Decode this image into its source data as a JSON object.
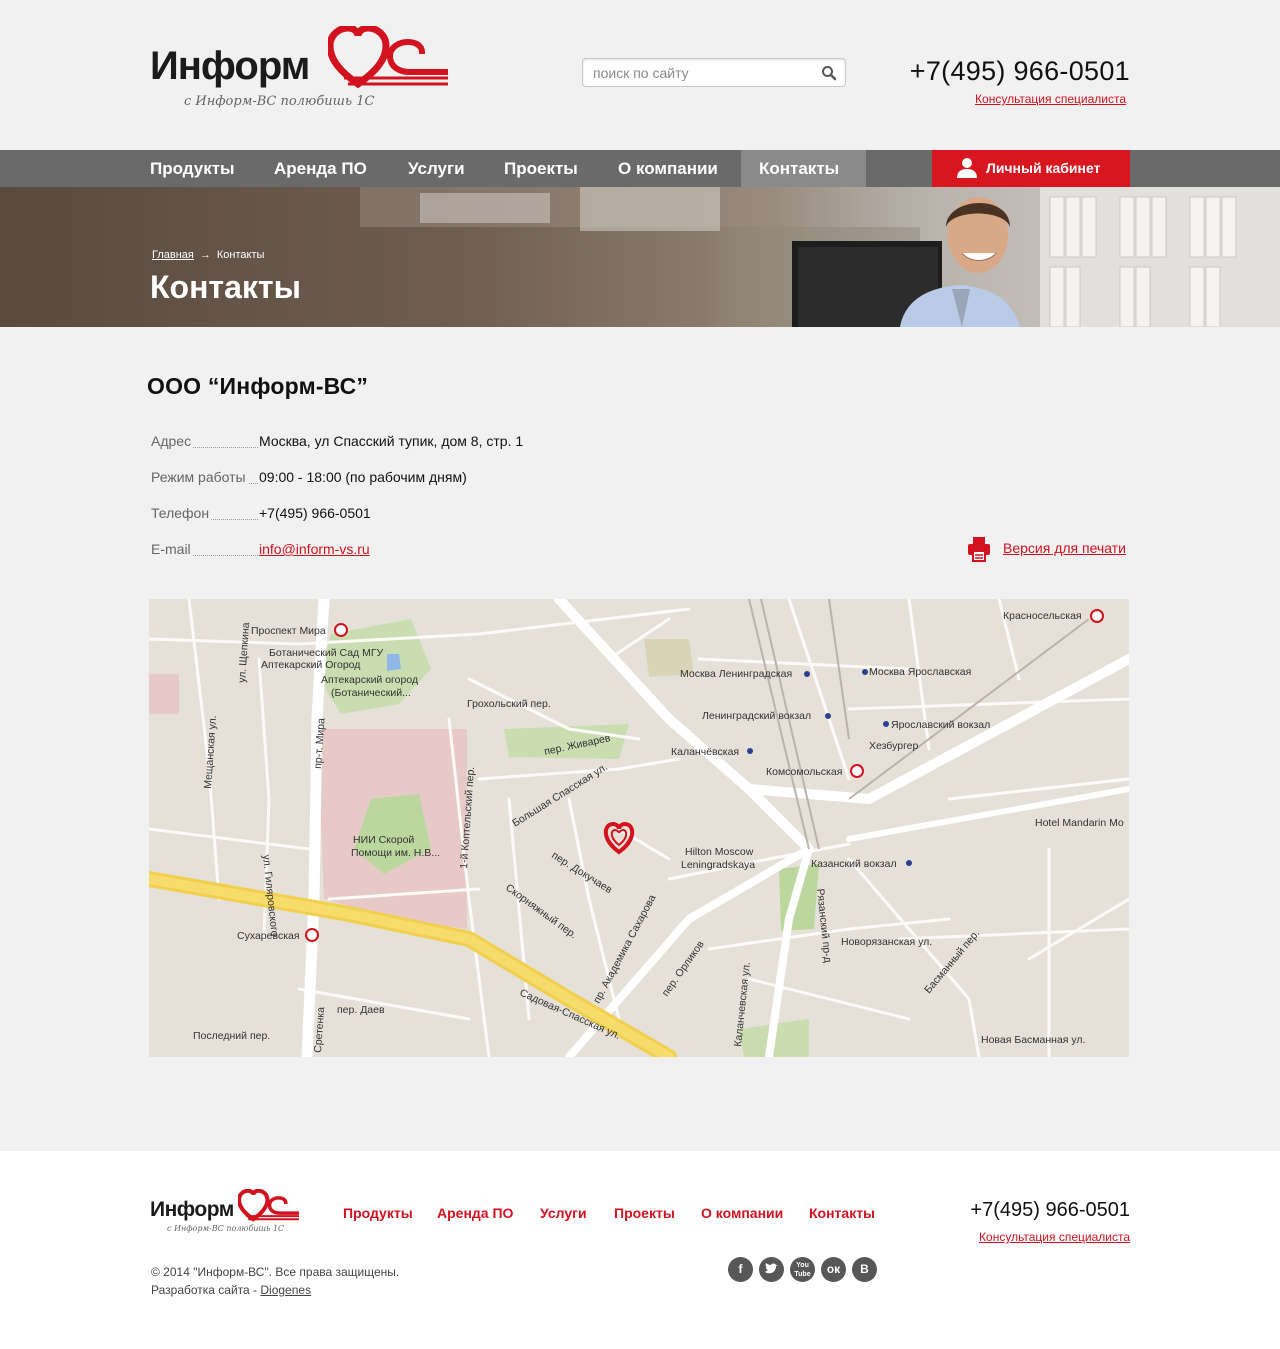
{
  "brand": {
    "name": "Информ",
    "mark": "ВС",
    "slogan": "с Информ-ВС полюбишь 1С",
    "accent_color": "#d3121f"
  },
  "header": {
    "search_placeholder": "поиск по сайту",
    "phone": "+7(495) 966-0501",
    "consult_link": "Консультация специалиста"
  },
  "nav": {
    "items": [
      {
        "label": "Продукты"
      },
      {
        "label": "Аренда ПО"
      },
      {
        "label": "Услуги"
      },
      {
        "label": "Проекты"
      },
      {
        "label": "О компании"
      },
      {
        "label": "Контакты",
        "active": true
      }
    ],
    "cabinet_label": "Личный кабинет"
  },
  "banner": {
    "breadcrumb_home": "Главная",
    "breadcrumb_arrow": "→",
    "breadcrumb_current": "Контакты",
    "title": "Контакты"
  },
  "contacts": {
    "company": "ООО “Информ-ВС”",
    "rows": [
      {
        "label": "Адрес",
        "value": "Москва, ул Спасский тупик, дом 8, стр. 1"
      },
      {
        "label": "Режим работы",
        "value": "09:00 - 18:00 (по рабочим дням)"
      },
      {
        "label": "Телефон",
        "value": "+7(495) 966-0501"
      },
      {
        "label": "E-mail",
        "value": "info@inform-vs.ru"
      }
    ],
    "print_label": "Версия для печати"
  },
  "map": {
    "labels": [
      "Проспект Мира",
      "Ботанический Сад МГУ",
      "Аптекарский Огород",
      "Аптекарский огород",
      "(Ботанический...",
      "Москва Ленинградская",
      "Москва Ярославская",
      "Красносельская",
      "Ленинградский вокзал",
      "Ярославский вокзал",
      "Хезбургер",
      "Каланчёвская",
      "Комсомольская",
      "Hotel Mandarin Mo",
      "Hilton Moscow",
      "Leningradskaya",
      "Казанский вокзал",
      "НИИ Скорой",
      "Помощи им. Н.В...",
      "Сухаревская",
      "Садовая-Спасская ул.",
      "пр. Академика Сахарова",
      "пер. Орликов",
      "Каланчевская ул.",
      "Новорязанская ул.",
      "Новая Басманная ул.",
      "Грохольский пер.",
      "пер. Живарев",
      "Большая Спасская ул.",
      "пер. Докучаев",
      "Скорняжный пер.",
      "пер. Даев",
      "Последний пер.",
      "Сретенка",
      "пр-т. Мира",
      "Мещанская ул.",
      "ул. Щепкина",
      "ул. Гиляровского",
      "1-й Коптельский пер.",
      "Рязанский пр-д",
      "Басманный пер."
    ]
  },
  "footer": {
    "nav": [
      "Продукты",
      "Аренда ПО",
      "Услуги",
      "Проекты",
      "О компании",
      "Контакты"
    ],
    "phone": "+7(495) 966-0501",
    "consult_link": "Консультация специалиста",
    "copyright": "© 2014 \"Информ-ВС\". Все права защищены.",
    "dev_prefix": "Разработка сайта - ",
    "dev_name": "Diogenes",
    "socials": [
      {
        "name": "facebook",
        "glyph": "f"
      },
      {
        "name": "twitter",
        "glyph": "t"
      },
      {
        "name": "youtube",
        "glyph": "You Tube"
      },
      {
        "name": "odnoklassniki",
        "glyph": "ок"
      },
      {
        "name": "vkontakte",
        "glyph": "В"
      }
    ]
  }
}
